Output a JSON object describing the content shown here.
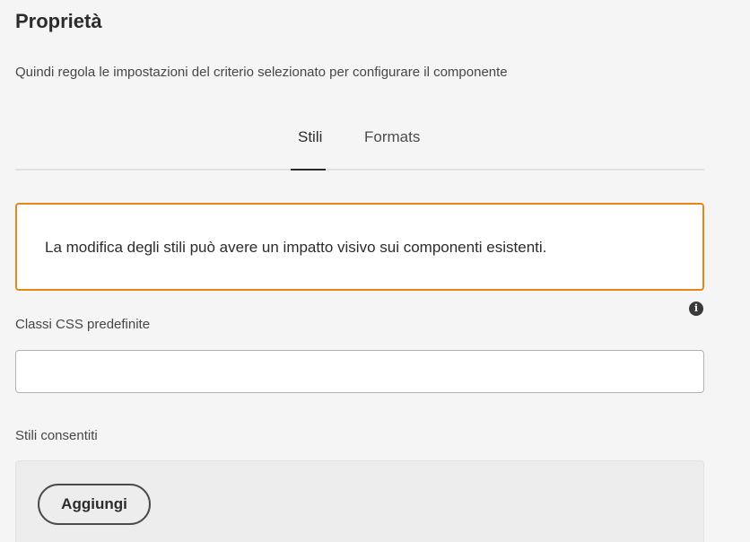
{
  "header": {
    "title": "Proprietà",
    "subtitle": "Quindi regola le impostazioni del criterio selezionato per configurare il componente"
  },
  "tabs": [
    {
      "label": "Stili",
      "selected": true
    },
    {
      "label": "Formats",
      "selected": false
    }
  ],
  "alert": {
    "text": "La modifica degli stili può avere un impatto visivo sui componenti esistenti.",
    "border_color": "#e68619"
  },
  "css_classes": {
    "label": "Classi CSS predefinite",
    "value": "",
    "info_icon": "info-icon"
  },
  "allowed_styles": {
    "label": "Stili consentiti",
    "add_button_label": "Aggiungi"
  },
  "colors": {
    "background": "#f5f5f5",
    "text": "#2c2c2c",
    "warning": "#e68619"
  }
}
